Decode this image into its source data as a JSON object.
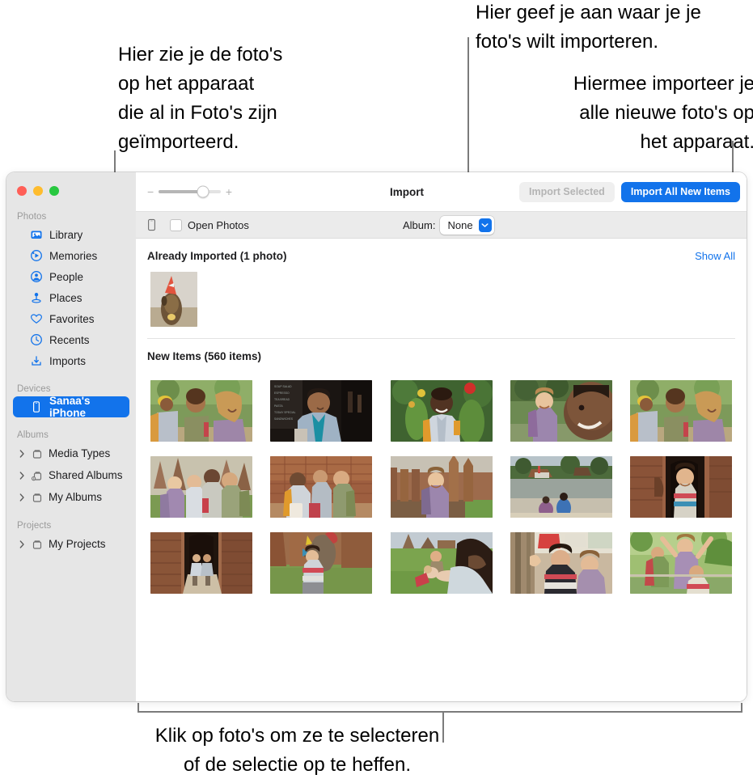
{
  "annotations": {
    "left": "Hier zie je de foto's\nop het apparaat\ndie al in Foto's zijn\ngeïmporteerd.",
    "top_right": "Hier geef je aan waar je je\nfoto's wilt importeren.",
    "right_second": "Hiermee importeer je\nalle nieuwe foto's op\nhet apparaat.",
    "bottom": "Klik op foto's om ze te selecteren\nof de selectie op te heffen."
  },
  "window": {
    "traffic_lights": [
      "close",
      "minimize",
      "zoom"
    ]
  },
  "sidebar": {
    "sections": [
      {
        "header": "Photos",
        "items": [
          {
            "label": "Library",
            "icon": "library-icon",
            "selected": false
          },
          {
            "label": "Memories",
            "icon": "memories-icon",
            "selected": false
          },
          {
            "label": "People",
            "icon": "people-icon",
            "selected": false
          },
          {
            "label": "Places",
            "icon": "places-icon",
            "selected": false
          },
          {
            "label": "Favorites",
            "icon": "heart-icon",
            "selected": false
          },
          {
            "label": "Recents",
            "icon": "clock-icon",
            "selected": false
          },
          {
            "label": "Imports",
            "icon": "import-icon",
            "selected": false
          }
        ]
      },
      {
        "header": "Devices",
        "items": [
          {
            "label": "Sanaa's iPhone",
            "icon": "iphone-icon",
            "selected": true
          }
        ]
      },
      {
        "header": "Albums",
        "items": [
          {
            "label": "Media Types",
            "icon": "album-icon",
            "disclosure": true
          },
          {
            "label": "Shared Albums",
            "icon": "shared-album-icon",
            "disclosure": true
          },
          {
            "label": "My Albums",
            "icon": "album-icon",
            "disclosure": true
          }
        ]
      },
      {
        "header": "Projects",
        "items": [
          {
            "label": "My Projects",
            "icon": "album-icon",
            "disclosure": true
          }
        ]
      }
    ]
  },
  "toolbar": {
    "title": "Import",
    "zoom_minus": "−",
    "zoom_plus": "+",
    "zoom_value": 72,
    "import_selected_label": "Import Selected",
    "import_selected_enabled": false,
    "import_all_label": "Import All New Items",
    "accent_color": "#1273eb"
  },
  "subtoolbar": {
    "device_icon": "iphone-icon",
    "open_photos_label": "Open Photos",
    "open_photos_checked": false,
    "album_label": "Album:",
    "album_value": "None",
    "album_options": [
      "None"
    ]
  },
  "content": {
    "already_imported": {
      "title": "Already Imported (1 photo)",
      "show_all_label": "Show All",
      "thumbs": [
        {
          "alt": "dog-with-party-hat"
        }
      ]
    },
    "new_items": {
      "title": "New Items (560 items)",
      "thumbs": [
        {
          "alt": "two-women-hiking-garden"
        },
        {
          "alt": "man-at-cafe-chalkboard"
        },
        {
          "alt": "man-smiling-with-flowers"
        },
        {
          "alt": "woman-backpack-and-face"
        },
        {
          "alt": "two-women-walking-path"
        },
        {
          "alt": "group-of-four-at-temple"
        },
        {
          "alt": "three-friends-sitting-ruins"
        },
        {
          "alt": "woman-at-brick-temple"
        },
        {
          "alt": "two-people-by-river-boat"
        },
        {
          "alt": "woman-in-temple-doorway"
        },
        {
          "alt": "couple-in-temple-corridor"
        },
        {
          "alt": "woman-with-elephant-statue"
        },
        {
          "alt": "friends-relaxing-on-grass"
        },
        {
          "alt": "women-at-market-stall"
        },
        {
          "alt": "woman-arms-raised-outdoors"
        }
      ]
    }
  }
}
